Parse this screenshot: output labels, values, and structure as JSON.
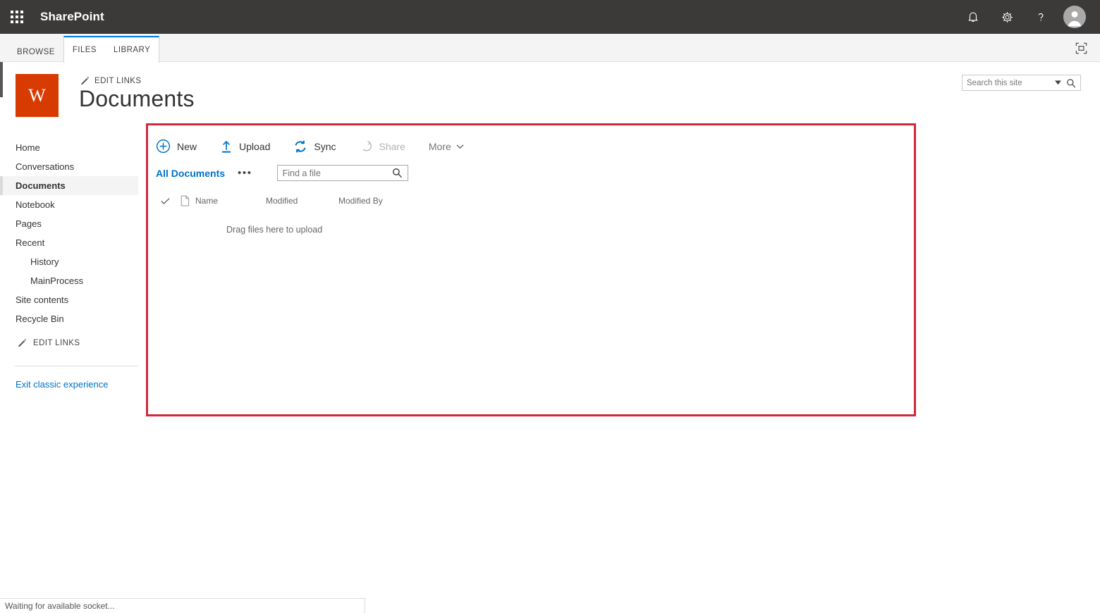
{
  "suite": {
    "brand": "SharePoint",
    "waffle_name": "app-launcher",
    "icons": [
      "notifications-icon",
      "settings-gear-icon",
      "help-icon",
      "user-avatar"
    ]
  },
  "ribbon": {
    "tabs": [
      {
        "label": "BROWSE",
        "active": false,
        "grouped": false
      },
      {
        "label": "FILES",
        "active": true,
        "grouped": true
      },
      {
        "label": "LIBRARY",
        "active": false,
        "grouped": true
      }
    ],
    "focus_on_content": "focus-on-content-icon"
  },
  "site": {
    "logo_letter": "W",
    "logo_color": "#d83b01",
    "edit_links_label": "EDIT LINKS",
    "title": "Documents"
  },
  "search": {
    "placeholder": "Search this site",
    "value": ""
  },
  "nav": {
    "items": [
      {
        "label": "Home",
        "selected": false,
        "sub": false
      },
      {
        "label": "Conversations",
        "selected": false,
        "sub": false
      },
      {
        "label": "Documents",
        "selected": true,
        "sub": false
      },
      {
        "label": "Notebook",
        "selected": false,
        "sub": false
      },
      {
        "label": "Pages",
        "selected": false,
        "sub": false
      },
      {
        "label": "Recent",
        "selected": false,
        "sub": false
      },
      {
        "label": "History",
        "selected": false,
        "sub": true
      },
      {
        "label": "MainProcess",
        "selected": false,
        "sub": true
      },
      {
        "label": "Site contents",
        "selected": false,
        "sub": false
      },
      {
        "label": "Recycle Bin",
        "selected": false,
        "sub": false
      }
    ],
    "edit_links_label": "EDIT LINKS",
    "exit_label": "Exit classic experience"
  },
  "library": {
    "commands": [
      {
        "label": "New",
        "icon": "plus-circle-icon",
        "disabled": false
      },
      {
        "label": "Upload",
        "icon": "upload-arrow-icon",
        "disabled": false
      },
      {
        "label": "Sync",
        "icon": "sync-icon",
        "disabled": false
      },
      {
        "label": "Share",
        "icon": "share-icon",
        "disabled": true
      }
    ],
    "more_label": "More",
    "view_name": "All Documents",
    "view_ellipsis": "•••",
    "find_file_placeholder": "Find a file",
    "find_file_value": "",
    "columns": [
      {
        "label": "Name"
      },
      {
        "label": "Modified"
      },
      {
        "label": "Modified By"
      }
    ],
    "empty_message": "Drag files here to upload",
    "accent_color": "#0072c6",
    "highlight_color": "#d1283c"
  },
  "status": {
    "text": "Waiting for available socket..."
  }
}
